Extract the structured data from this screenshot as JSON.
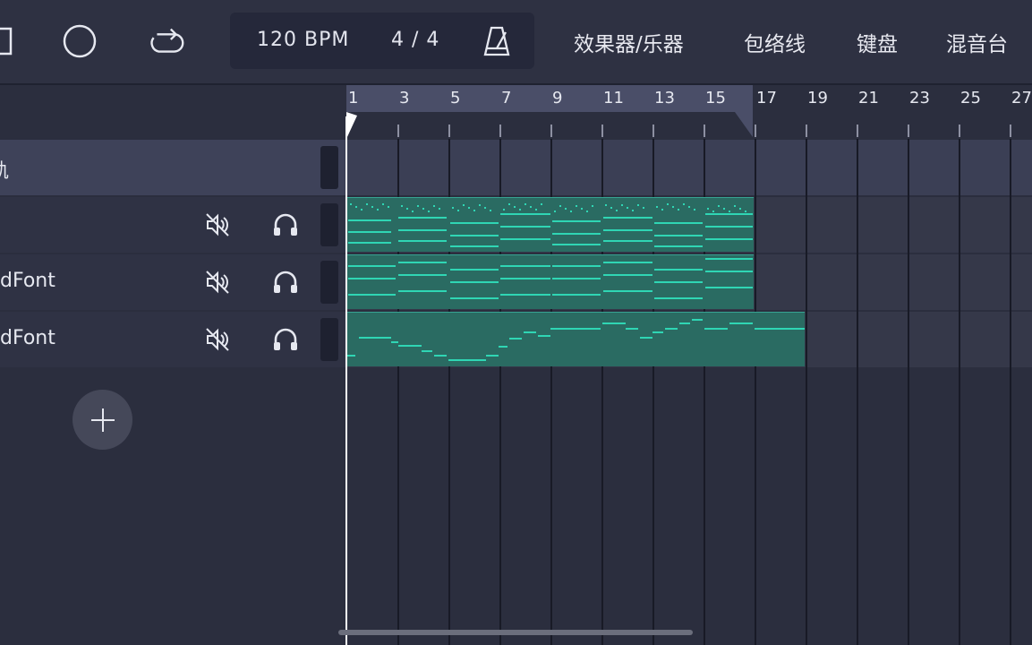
{
  "toolbar": {
    "tempo": "120 BPM",
    "time_signature": "4 / 4",
    "menu": [
      "效果器/乐器",
      "包络线",
      "键盘",
      "混音台"
    ]
  },
  "tracks": [
    {
      "name": "轨"
    },
    {
      "name": ""
    },
    {
      "name": "dFont"
    },
    {
      "name": "dFont"
    }
  ],
  "ruler": {
    "bar_labels": [
      "1",
      "3",
      "5",
      "7",
      "9",
      "11",
      "13",
      "15",
      "17",
      "19",
      "21",
      "23",
      "25",
      "27"
    ]
  },
  "colors": {
    "accent": "#1fb89c",
    "clip_fill": "#2a6b62",
    "background": "#2b2e3e",
    "loop_region": "#4a4e68"
  }
}
